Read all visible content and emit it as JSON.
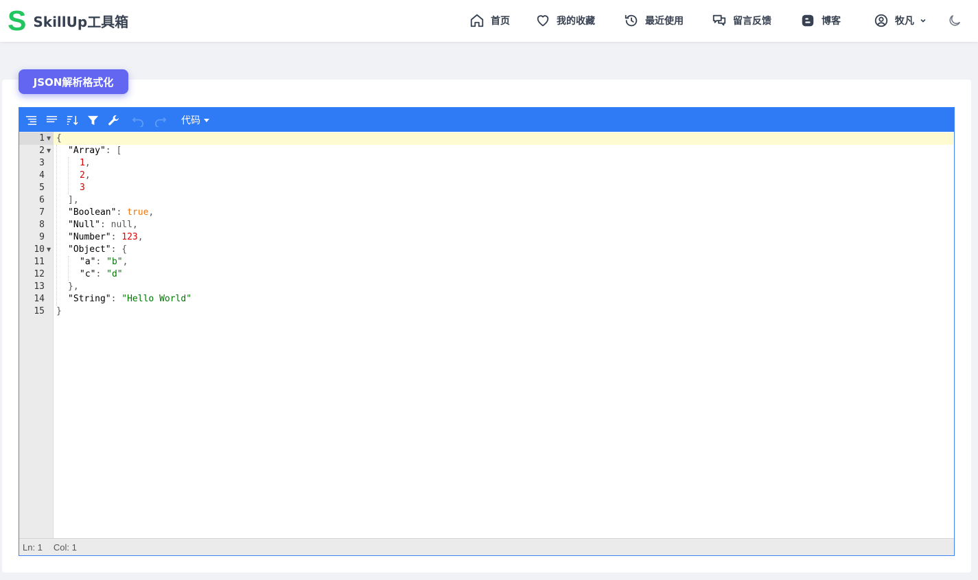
{
  "app": {
    "logo_letter": "S",
    "brand": "SkillUp工具箱",
    "brand_color": "#22c55e"
  },
  "nav": {
    "items": [
      {
        "label": "首页",
        "icon": "home-icon"
      },
      {
        "label": "我的收藏",
        "icon": "heart-icon"
      },
      {
        "label": "最近使用",
        "icon": "history-icon"
      },
      {
        "label": "留言反馈",
        "icon": "chat-icon"
      },
      {
        "label": "博客",
        "icon": "blogger-icon"
      }
    ],
    "user": {
      "label": "牧凡",
      "icon": "user-circle-icon"
    },
    "theme_toggle_icon": "moon-icon"
  },
  "tool": {
    "title": "JSON解析格式化",
    "accent": "#6366f1"
  },
  "editor": {
    "toolbar": {
      "color": "#2f7af5",
      "buttons": [
        "format-icon",
        "compact-icon",
        "sort-icon",
        "filter-icon",
        "repair-icon",
        "undo-icon",
        "redo-icon"
      ],
      "mode_label": "代码"
    },
    "lines": [
      "1",
      "2",
      "3",
      "4",
      "5",
      "6",
      "7",
      "8",
      "9",
      "10",
      "11",
      "12",
      "13",
      "14",
      "15"
    ],
    "code": {
      "l1_open": "{",
      "l2_key": "\"Array\"",
      "l2_rest": ": [",
      "l3_val": "1",
      "l4_val": "2",
      "l5_val": "3",
      "comma": ",",
      "l6": "],",
      "l7_key": "\"Boolean\"",
      "l7_val": "true",
      "l8_key": "\"Null\"",
      "l8_val": "null",
      "l9_key": "\"Number\"",
      "l9_val": "123",
      "l10_key": "\"Object\"",
      "l10_rest": ": {",
      "l11_key": "\"a\"",
      "l11_val": "\"b\"",
      "l12_key": "\"c\"",
      "l12_val": "\"d\"",
      "l13": "},",
      "l14_key": "\"String\"",
      "l14_val": "\"Hello World\"",
      "l15_close": "}",
      "colon": ": "
    },
    "status": {
      "ln": "Ln: 1",
      "col": "Col: 1"
    }
  }
}
